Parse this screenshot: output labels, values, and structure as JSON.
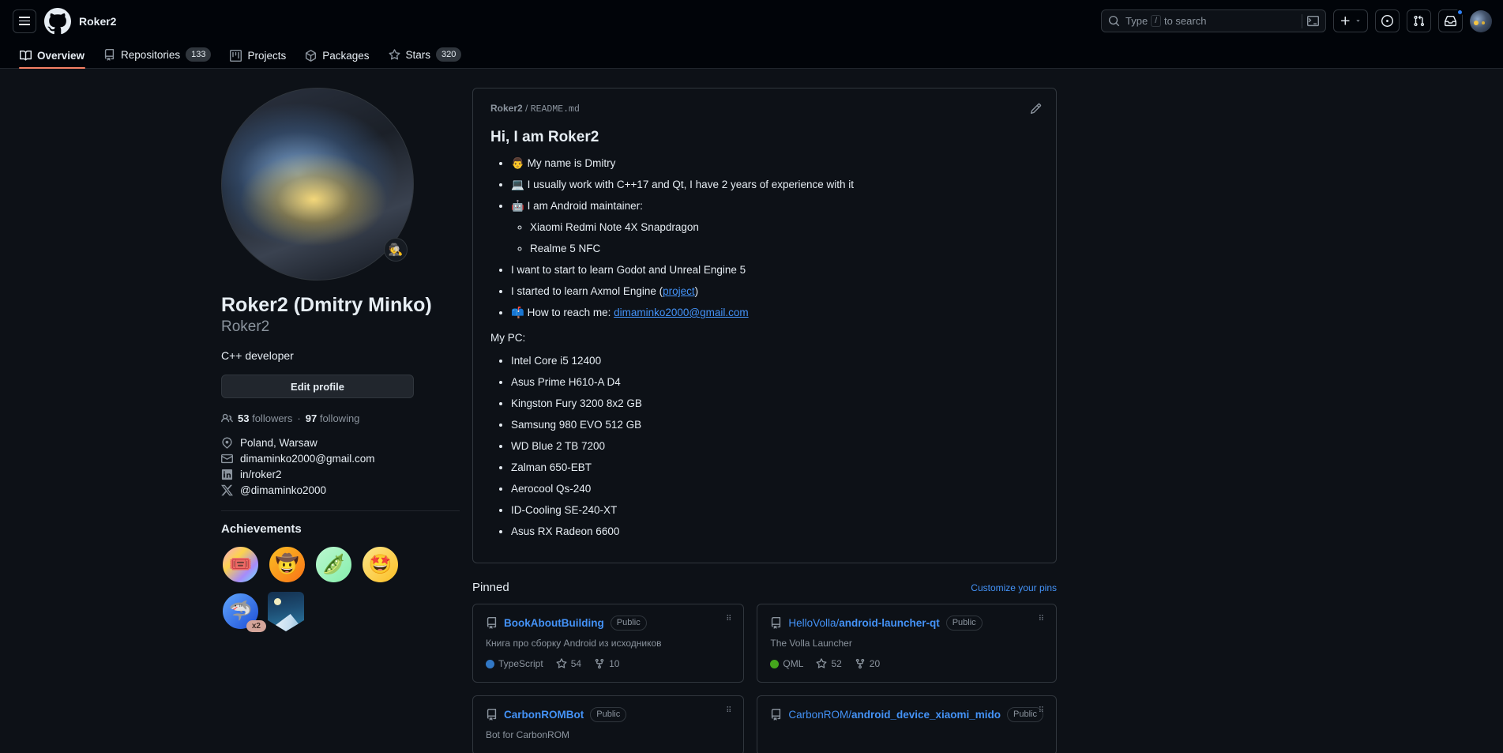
{
  "header": {
    "owner": "Roker2",
    "search_placeholder": "Type / to search",
    "search_key": "/"
  },
  "nav": {
    "tabs": [
      {
        "label": "Overview",
        "icon": "book-icon",
        "count": null,
        "active": true
      },
      {
        "label": "Repositories",
        "icon": "repo-icon",
        "count": "133",
        "active": false
      },
      {
        "label": "Projects",
        "icon": "project-icon",
        "count": null,
        "active": false
      },
      {
        "label": "Packages",
        "icon": "package-icon",
        "count": null,
        "active": false
      },
      {
        "label": "Stars",
        "icon": "star-icon",
        "count": "320",
        "active": false
      }
    ]
  },
  "profile": {
    "full_name": "Roker2 (Dmitry Minko)",
    "login": "Roker2",
    "bio": "C++ developer",
    "edit_label": "Edit profile",
    "status_emoji": "🕵️",
    "followers_count": "53",
    "followers_label": "followers",
    "separator": "·",
    "following_count": "97",
    "following_label": "following",
    "contacts": [
      {
        "icon": "location-icon",
        "text": "Poland, Warsaw"
      },
      {
        "icon": "mail-icon",
        "text": "dimaminko2000@gmail.com"
      },
      {
        "icon": "linkedin-icon",
        "text": "in/roker2"
      },
      {
        "icon": "x-twitter-icon",
        "text": "@dimaminko2000"
      }
    ],
    "achievements_title": "Achievements",
    "badges": [
      {
        "name": "yolo-badge",
        "emoji": "🎟️",
        "bg": "linear-gradient(135deg,#f9a8d4,#fcd34d,#a78bfa,#67e8f9)",
        "multiplier": null
      },
      {
        "name": "quickdraw-badge",
        "emoji": "🤠",
        "bg": "linear-gradient(135deg,#fbbf24,#f97316)",
        "multiplier": null
      },
      {
        "name": "pair-extraordinaire-badge",
        "emoji": "🫛",
        "bg": "linear-gradient(135deg,#bbf7d0,#86efac)",
        "multiplier": null
      },
      {
        "name": "starstruck-badge",
        "emoji": "🤩",
        "bg": "linear-gradient(135deg,#fde68a,#fbbf24)",
        "multiplier": null
      },
      {
        "name": "pull-shark-badge",
        "emoji": "🦈",
        "bg": "linear-gradient(135deg,#60a5fa,#2563eb)",
        "multiplier": "x2"
      }
    ],
    "shield_badge_name": "arctic-code-vault-badge"
  },
  "readme": {
    "path_owner": "Roker2",
    "path_sep": "/",
    "path_file": "README",
    "path_ext": ".md",
    "edit_icon": "pencil-icon",
    "heading": "Hi, I am Roker2",
    "items": [
      {
        "emoji": "👨",
        "text": "My name is Dmitry",
        "sub": []
      },
      {
        "emoji": "💻",
        "text": "I usually work with C++17 and Qt, I have 2 years of experience with it",
        "sub": []
      },
      {
        "emoji": "🤖",
        "text": "I am Android maintainer:",
        "sub": [
          "Xiaomi Redmi Note 4X Snapdragon",
          "Realme 5 NFC"
        ]
      },
      {
        "emoji": "",
        "text": "I want to start to learn Godot and Unreal Engine 5",
        "sub": []
      },
      {
        "emoji": "",
        "text": "I started to learn Axmol Engine (",
        "link": "project",
        "text_after": ")",
        "sub": []
      },
      {
        "emoji": "📫",
        "text": "How to reach me: ",
        "link": "dimaminko2000@gmail.com",
        "text_after": "",
        "sub": []
      }
    ],
    "pc_heading": "My PC:",
    "pc_items": [
      "Intel Core i5 12400",
      "Asus Prime H610-A D4",
      "Kingston Fury 3200 8x2 GB",
      "Samsung 980 EVO 512 GB",
      "WD Blue 2 TB 7200",
      "Zalman 650-EBT",
      "Aerocool Qs-240",
      "ID-Cooling SE-240-XT",
      "Asus RX Radeon 6600"
    ]
  },
  "pinned": {
    "title": "Pinned",
    "customize_label": "Customize your pins",
    "cards": [
      {
        "owner": "",
        "name": "BookAboutBuilding",
        "visibility": "Public",
        "description": "Книга про сборку Android из исходников",
        "language": "TypeScript",
        "language_color": "#3178c6",
        "stars": "54",
        "forks": "10"
      },
      {
        "owner": "HelloVolla/",
        "name": "android-launcher-qt",
        "visibility": "Public",
        "description": "The Volla Launcher",
        "language": "QML",
        "language_color": "#44a51c",
        "stars": "52",
        "forks": "20"
      },
      {
        "owner": "",
        "name": "CarbonROMBot",
        "visibility": "Public",
        "description": "Bot for CarbonROM",
        "language": "",
        "language_color": "",
        "stars": "",
        "forks": ""
      },
      {
        "owner": "CarbonROM/",
        "name": "android_device_xiaomi_mido",
        "visibility": "Public",
        "description": "",
        "language": "",
        "language_color": "",
        "stars": "",
        "forks": ""
      }
    ]
  },
  "colors": {
    "background": "#0d1117",
    "header_bg": "#010409",
    "border": "#30363d",
    "link": "#4493f8",
    "muted": "#8b949e",
    "accent_tab": "#f78166"
  }
}
